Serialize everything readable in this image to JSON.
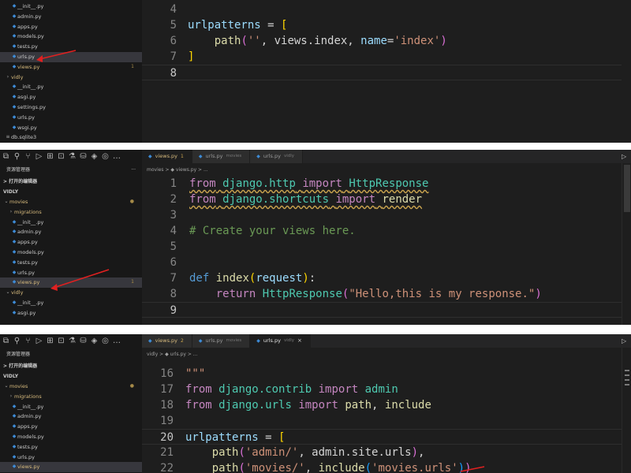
{
  "top": {
    "explorer": [
      {
        "label": "__init__.py",
        "type": "py",
        "indent": 14
      },
      {
        "label": "admin.py",
        "type": "py",
        "indent": 14
      },
      {
        "label": "apps.py",
        "type": "py",
        "indent": 14
      },
      {
        "label": "models.py",
        "type": "py",
        "indent": 14
      },
      {
        "label": "tests.py",
        "type": "py",
        "indent": 14
      },
      {
        "label": "urls.py",
        "type": "py",
        "indent": 14,
        "active": true
      },
      {
        "label": "views.py",
        "type": "py",
        "indent": 14,
        "yellow": true,
        "count": "1"
      },
      {
        "label": "vidly",
        "type": "folder",
        "indent": 6
      },
      {
        "label": "__init__.py",
        "type": "py",
        "indent": 14
      },
      {
        "label": "asgi.py",
        "type": "py",
        "indent": 14
      },
      {
        "label": "settings.py",
        "type": "py",
        "indent": 14
      },
      {
        "label": "urls.py",
        "type": "py",
        "indent": 14
      },
      {
        "label": "wsgi.py",
        "type": "py",
        "indent": 14
      },
      {
        "label": "db.sqlite3",
        "type": "db",
        "indent": 6
      }
    ],
    "lines": [
      {
        "n": "4",
        "tokens": []
      },
      {
        "n": "5",
        "tokens": [
          [
            "vr",
            "urlpatterns"
          ],
          [
            "",
            " = "
          ],
          [
            "br",
            "["
          ]
        ]
      },
      {
        "n": "6",
        "tokens": [
          [
            "",
            "    "
          ],
          [
            "fn",
            "path"
          ],
          [
            "br2",
            "("
          ],
          [
            "st",
            "''"
          ],
          [
            "",
            ", views.index, "
          ],
          [
            "vr",
            "name"
          ],
          [
            "",
            "="
          ],
          [
            "st",
            "'index'"
          ],
          [
            "br2",
            ")"
          ]
        ]
      },
      {
        "n": "7",
        "tokens": [
          [
            "br",
            "]"
          ]
        ]
      },
      {
        "n": "8",
        "tokens": [],
        "current": true
      }
    ]
  },
  "mid": {
    "activity_icons": [
      "files-icon",
      "search-icon",
      "source-control-icon",
      "run-debug-icon",
      "extensions-icon",
      "remote-icon",
      "test-icon",
      "docker-icon",
      "python-icon",
      "chat-icon",
      "more-icon"
    ],
    "activity_glyphs": [
      "⧉",
      "⚲",
      "⑂",
      "▷",
      "⊞",
      "⊡",
      "⚗",
      "⛁",
      "◈",
      "◎",
      "…"
    ],
    "explorer_title": "资源管理器",
    "explorer_menu": "···",
    "open_editors": "> 打开的编辑器",
    "workspace": "VIDLY",
    "explorer": [
      {
        "label": "movies",
        "type": "folder-open",
        "indent": 4,
        "yellow": true,
        "dot": "●"
      },
      {
        "label": "migrations",
        "type": "folder",
        "indent": 10
      },
      {
        "label": "__init__.py",
        "type": "py",
        "indent": 14
      },
      {
        "label": "admin.py",
        "type": "py",
        "indent": 14
      },
      {
        "label": "apps.py",
        "type": "py",
        "indent": 14
      },
      {
        "label": "models.py",
        "type": "py",
        "indent": 14
      },
      {
        "label": "tests.py",
        "type": "py",
        "indent": 14
      },
      {
        "label": "urls.py",
        "type": "py",
        "indent": 14
      },
      {
        "label": "views.py",
        "type": "py",
        "indent": 14,
        "yellow": true,
        "active": true,
        "count": "1"
      },
      {
        "label": "vidly",
        "type": "folder-open",
        "indent": 6
      },
      {
        "label": "__init__.py",
        "type": "py",
        "indent": 14
      },
      {
        "label": "asgi.py",
        "type": "py",
        "indent": 14
      }
    ],
    "tabs": [
      {
        "name": "views.py",
        "sub": "",
        "badge": "1",
        "active": true,
        "modified": true
      },
      {
        "name": "urls.py",
        "sub": "movies",
        "badge": "",
        "active": false,
        "modified": false
      },
      {
        "name": "urls.py",
        "sub": "vidly",
        "badge": "",
        "active": false,
        "modified": false
      }
    ],
    "run_icon": "▷",
    "breadcrumb": "movies > ◆ views.py > ...",
    "lines": [
      {
        "n": "1",
        "tokens": [
          [
            "kw2 sq",
            "from"
          ],
          [
            "sq",
            " "
          ],
          [
            "md sq",
            "django.http"
          ],
          [
            "sq",
            " "
          ],
          [
            "kw2 sq",
            "import"
          ],
          [
            "sq",
            " "
          ],
          [
            "md sq",
            "HttpResponse"
          ]
        ]
      },
      {
        "n": "2",
        "tokens": [
          [
            "kw2 sq",
            "from"
          ],
          [
            "sq",
            " "
          ],
          [
            "md sq",
            "django.shortcuts"
          ],
          [
            "sq",
            " "
          ],
          [
            "kw2 sq",
            "import"
          ],
          [
            "sq",
            " "
          ],
          [
            "fn sq",
            "render"
          ]
        ]
      },
      {
        "n": "3",
        "tokens": []
      },
      {
        "n": "4",
        "tokens": [
          [
            "cm",
            "# Create your views here."
          ]
        ]
      },
      {
        "n": "5",
        "tokens": []
      },
      {
        "n": "6",
        "tokens": []
      },
      {
        "n": "7",
        "tokens": [
          [
            "kw",
            "def"
          ],
          [
            "",
            " "
          ],
          [
            "fn",
            "index"
          ],
          [
            "br",
            "("
          ],
          [
            "vr",
            "request"
          ],
          [
            "br",
            ")"
          ],
          [
            "",
            ":"
          ]
        ]
      },
      {
        "n": "8",
        "tokens": [
          [
            "",
            "    "
          ],
          [
            "kw2",
            "return"
          ],
          [
            "",
            " "
          ],
          [
            "md",
            "HttpResponse"
          ],
          [
            "br2",
            "("
          ],
          [
            "st",
            "\"Hello,this is my response.\""
          ],
          [
            "br2",
            ")"
          ]
        ]
      },
      {
        "n": "9",
        "tokens": [],
        "current": true
      }
    ]
  },
  "bot": {
    "activity_glyphs": [
      "⧉",
      "⚲",
      "⑂",
      "▷",
      "⊞",
      "⊡",
      "⚗",
      "⛁",
      "◈",
      "◎",
      "…"
    ],
    "explorer_title": "资源管理器",
    "open_editors": "> 打开的编辑器",
    "workspace": "VIDLY",
    "explorer": [
      {
        "label": "movies",
        "type": "folder-open",
        "indent": 4,
        "yellow": true,
        "dot": "●"
      },
      {
        "label": "migrations",
        "type": "folder",
        "indent": 10
      },
      {
        "label": "__init__.py",
        "type": "py",
        "indent": 14
      },
      {
        "label": "admin.py",
        "type": "py",
        "indent": 14
      },
      {
        "label": "apps.py",
        "type": "py",
        "indent": 14
      },
      {
        "label": "models.py",
        "type": "py",
        "indent": 14
      },
      {
        "label": "tests.py",
        "type": "py",
        "indent": 14
      },
      {
        "label": "urls.py",
        "type": "py",
        "indent": 14
      },
      {
        "label": "views.py",
        "type": "py",
        "indent": 14,
        "yellow": true,
        "active": true
      }
    ],
    "tabs": [
      {
        "name": "views.py",
        "sub": "",
        "badge": "2",
        "active": false,
        "modified": true
      },
      {
        "name": "urls.py",
        "sub": "movies",
        "badge": "",
        "active": false,
        "modified": false
      },
      {
        "name": "urls.py",
        "sub": "vidly",
        "badge": "",
        "active": true,
        "modified": false,
        "close": "×"
      }
    ],
    "run_icon": "▷",
    "breadcrumb": "vidly > ◆ urls.py > ...",
    "lines": [
      {
        "n": "16",
        "tokens": [
          [
            "st",
            "\"\"\""
          ]
        ]
      },
      {
        "n": "17",
        "tokens": [
          [
            "kw2",
            "from"
          ],
          [
            "",
            " "
          ],
          [
            "md",
            "django.contrib"
          ],
          [
            "",
            " "
          ],
          [
            "kw2",
            "import"
          ],
          [
            "",
            " "
          ],
          [
            "md",
            "admin"
          ]
        ]
      },
      {
        "n": "18",
        "tokens": [
          [
            "kw2",
            "from"
          ],
          [
            "",
            " "
          ],
          [
            "md",
            "django.urls"
          ],
          [
            "",
            " "
          ],
          [
            "kw2",
            "import"
          ],
          [
            "",
            " "
          ],
          [
            "fn",
            "path"
          ],
          [
            "",
            ", "
          ],
          [
            "fn",
            "include"
          ]
        ]
      },
      {
        "n": "19",
        "tokens": []
      },
      {
        "n": "20",
        "tokens": [
          [
            "vr",
            "urlpatterns"
          ],
          [
            "",
            " = "
          ],
          [
            "br",
            "["
          ]
        ],
        "current": true
      },
      {
        "n": "21",
        "tokens": [
          [
            "",
            "    "
          ],
          [
            "fn",
            "path"
          ],
          [
            "br2",
            "("
          ],
          [
            "st",
            "'admin/'"
          ],
          [
            "",
            ", admin.site.urls"
          ],
          [
            "br2",
            ")"
          ],
          [
            "",
            ","
          ]
        ]
      },
      {
        "n": "22",
        "tokens": [
          [
            "",
            "    "
          ],
          [
            "fn",
            "path"
          ],
          [
            "br2",
            "("
          ],
          [
            "st",
            "'movies/'"
          ],
          [
            "",
            ", "
          ],
          [
            "fn",
            "include"
          ],
          [
            "br3",
            "("
          ],
          [
            "st",
            "'movies.urls'"
          ],
          [
            "br3",
            ")"
          ],
          [
            "br2",
            ")"
          ]
        ]
      }
    ]
  }
}
